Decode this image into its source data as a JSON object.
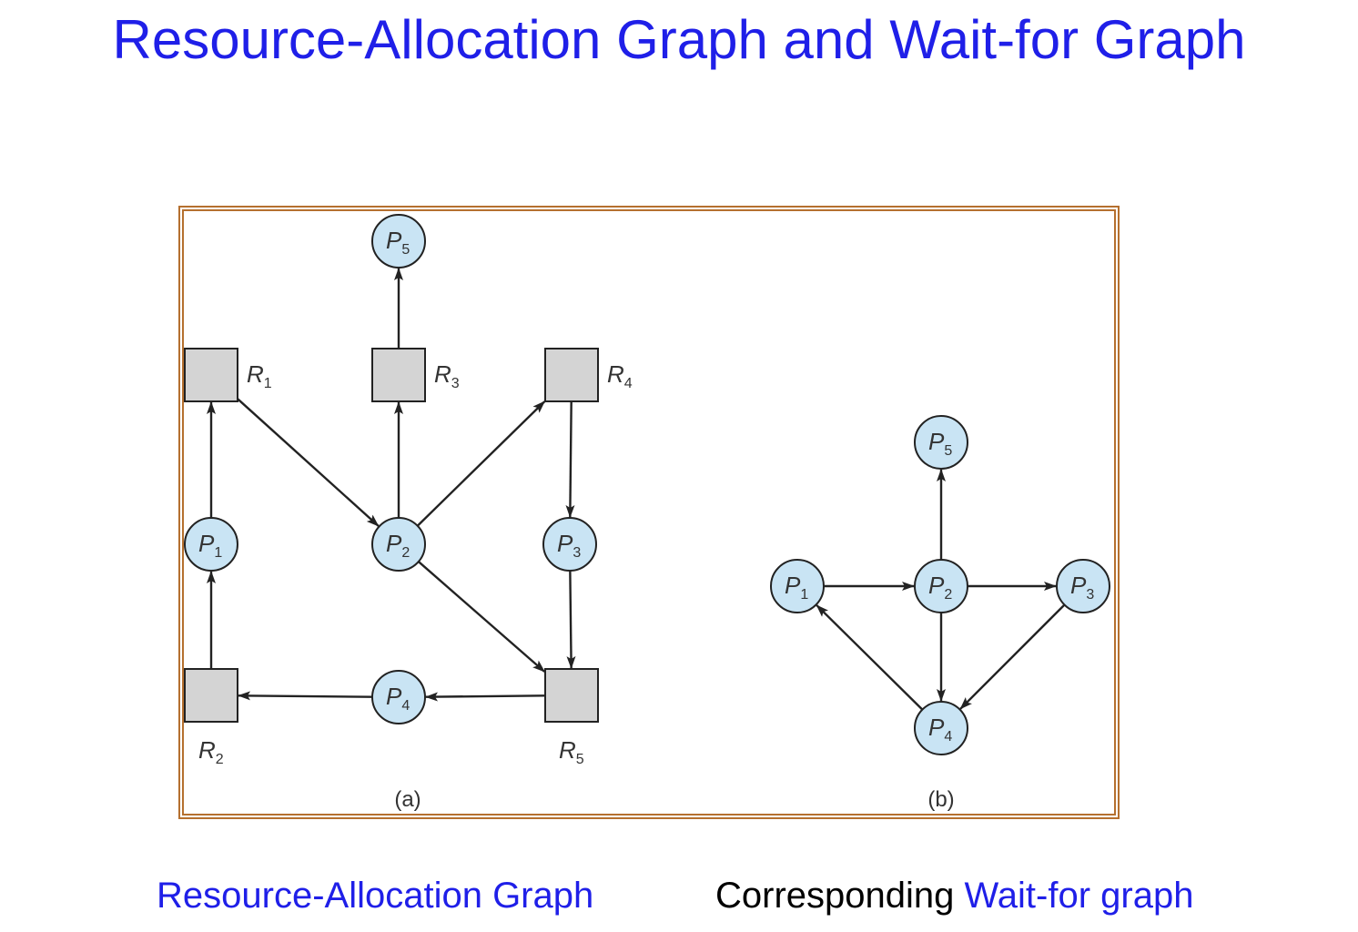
{
  "title": "Resource-Allocation Graph and Wait-for Graph",
  "colors": {
    "title": "#1f1fe8",
    "frame": "#b5702f",
    "process_fill": "#c9e4f4",
    "resource_fill": "#d4d4d4",
    "edge": "#222222"
  },
  "graph_a": {
    "label": "(a)",
    "processes": [
      {
        "id": "P1",
        "letter": "P",
        "sub": "1"
      },
      {
        "id": "P2",
        "letter": "P",
        "sub": "2"
      },
      {
        "id": "P3",
        "letter": "P",
        "sub": "3"
      },
      {
        "id": "P4",
        "letter": "P",
        "sub": "4"
      },
      {
        "id": "P5",
        "letter": "P",
        "sub": "5"
      }
    ],
    "resources": [
      {
        "id": "R1",
        "letter": "R",
        "sub": "1"
      },
      {
        "id": "R2",
        "letter": "R",
        "sub": "2"
      },
      {
        "id": "R3",
        "letter": "R",
        "sub": "3"
      },
      {
        "id": "R4",
        "letter": "R",
        "sub": "4"
      },
      {
        "id": "R5",
        "letter": "R",
        "sub": "5"
      }
    ],
    "edges": [
      {
        "from": "R3",
        "to": "P5"
      },
      {
        "from": "P1",
        "to": "R1"
      },
      {
        "from": "R1",
        "to": "P2"
      },
      {
        "from": "P2",
        "to": "R3"
      },
      {
        "from": "P2",
        "to": "R4"
      },
      {
        "from": "R4",
        "to": "P3"
      },
      {
        "from": "R2",
        "to": "P1"
      },
      {
        "from": "P2",
        "to": "R5"
      },
      {
        "from": "P3",
        "to": "R5"
      },
      {
        "from": "R5",
        "to": "P4"
      },
      {
        "from": "P4",
        "to": "R2"
      }
    ]
  },
  "graph_b": {
    "label": "(b)",
    "processes": [
      {
        "id": "P5",
        "letter": "P",
        "sub": "5"
      },
      {
        "id": "P1",
        "letter": "P",
        "sub": "1"
      },
      {
        "id": "P2",
        "letter": "P",
        "sub": "2"
      },
      {
        "id": "P3",
        "letter": "P",
        "sub": "3"
      },
      {
        "id": "P4",
        "letter": "P",
        "sub": "4"
      }
    ],
    "edges": [
      {
        "from": "P2",
        "to": "P5"
      },
      {
        "from": "P1",
        "to": "P2"
      },
      {
        "from": "P2",
        "to": "P3"
      },
      {
        "from": "P2",
        "to": "P4"
      },
      {
        "from": "P3",
        "to": "P4"
      },
      {
        "from": "P4",
        "to": "P1"
      }
    ]
  },
  "captions": {
    "left": "Resource-Allocation Graph",
    "right_prefix": "Corresponding",
    "right_highlight": "Wait-for graph"
  }
}
